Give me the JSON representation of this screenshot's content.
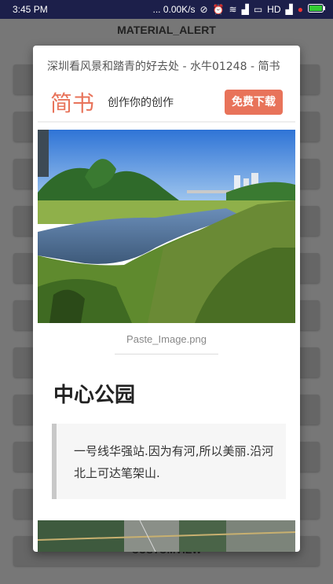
{
  "status_bar": {
    "time": "3:45 PM",
    "network_speed": "... 0.00K/s",
    "hd_label": "HD"
  },
  "background_app": {
    "title": "MATERIAL_ALERT",
    "footer": "CUSTOMVIEW"
  },
  "dialog": {
    "page_title": "深圳看风景和踏青的好去处 - 水牛01248 - 简书",
    "brand": "简书",
    "slogan": "创作你的创作",
    "download_button": "免费下载",
    "image_caption": "Paste_Image.png",
    "heading": "中心公园",
    "quote": "一号线华强站.因为有河,所以美丽.沿河北上可达笔架山."
  },
  "colors": {
    "brand_accent": "#e8735a",
    "status_bar": "#1c1f4a"
  }
}
